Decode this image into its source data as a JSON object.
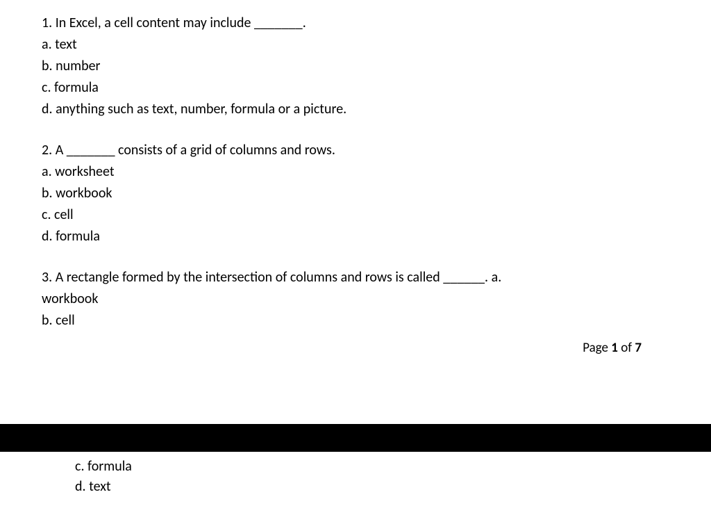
{
  "q1": {
    "text": "1. In Excel, a cell content may include _______.",
    "a": "a. text",
    "b": "b. number",
    "c": "c. formula",
    "d": "d. anything such as text, number, formula or a picture."
  },
  "q2": {
    "text": "2. A _______ consists of a grid of columns and rows.",
    "a": "a. worksheet",
    "b": "b. workbook",
    "c": "c. cell",
    "d": "d. formula"
  },
  "q3": {
    "text_part1": "3. A rectangle formed by the intersection of columns and rows  is called ______. a.",
    "a_wrapped": "workbook",
    "b": "b. cell",
    "c": "c. formula",
    "d": "d. text"
  },
  "footer": {
    "prefix": "Page ",
    "current": "1",
    "middle": " of ",
    "total": "7"
  }
}
